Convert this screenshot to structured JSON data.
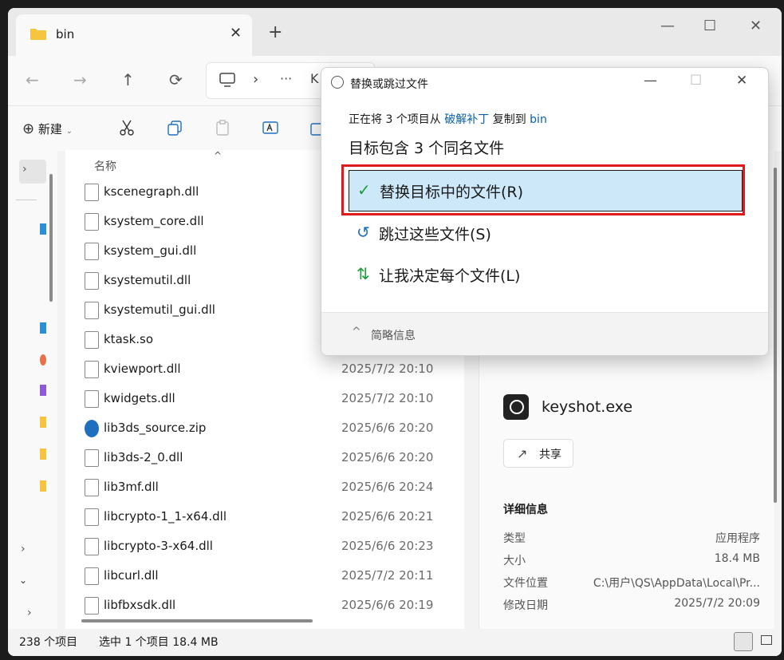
{
  "tab": {
    "title": "bin",
    "close": "✕",
    "new_tab": "+"
  },
  "window_controls": {
    "minimize": "—",
    "maximize": "☐",
    "close": "✕"
  },
  "nav": {
    "back": "←",
    "forward": "→",
    "up": "↑",
    "refresh": "⟳",
    "more": "···",
    "sep": "›",
    "partial_path": "K"
  },
  "toolbar": {
    "new_label": "新建",
    "new_icon": "⊕"
  },
  "file_list": {
    "column_name": "名称",
    "rows": [
      {
        "name": "kscenegraph.dll",
        "date": ""
      },
      {
        "name": "ksystem_core.dll",
        "date": ""
      },
      {
        "name": "ksystem_gui.dll",
        "date": ""
      },
      {
        "name": "ksystemutil.dll",
        "date": ""
      },
      {
        "name": "ksystemutil_gui.dll",
        "date": ""
      },
      {
        "name": "ktask.so",
        "date": ""
      },
      {
        "name": "kviewport.dll",
        "date": "2025/7/2 20:10"
      },
      {
        "name": "kwidgets.dll",
        "date": "2025/7/2 20:10"
      },
      {
        "name": "lib3ds_source.zip",
        "date": "2025/6/6 20:20"
      },
      {
        "name": "lib3ds-2_0.dll",
        "date": "2025/6/6 20:20"
      },
      {
        "name": "lib3mf.dll",
        "date": "2025/6/6 20:24"
      },
      {
        "name": "libcrypto-1_1-x64.dll",
        "date": "2025/6/6 20:21"
      },
      {
        "name": "libcrypto-3-x64.dll",
        "date": "2025/6/6 20:23"
      },
      {
        "name": "libcurl.dll",
        "date": "2025/7/2 20:11"
      },
      {
        "name": "libfbxsdk.dll",
        "date": "2025/6/6 20:19"
      }
    ]
  },
  "details": {
    "file_name": "keyshot.exe",
    "share_label": "共享",
    "heading": "详细信息",
    "props": [
      {
        "key": "类型",
        "value": "应用程序"
      },
      {
        "key": "大小",
        "value": "18.4 MB"
      },
      {
        "key": "文件位置",
        "value": "C:\\用户\\QS\\AppData\\Local\\Pr..."
      },
      {
        "key": "修改日期",
        "value": "2025/7/2 20:09"
      }
    ]
  },
  "status": {
    "count": "238 个项目",
    "selected": "选中 1 个项目  18.4 MB"
  },
  "dialog": {
    "title": "替换或跳过文件",
    "line1_pre": "正在将 3 个项目从",
    "line1_src": "破解补丁",
    "line1_mid": "复制到",
    "line1_dst": "bin",
    "line2": "目标包含 3 个同名文件",
    "opt_replace": "替换目标中的文件(R)",
    "opt_skip": "跳过这些文件(S)",
    "opt_decide": "让我决定每个文件(L)",
    "footer": "简略信息"
  },
  "colors": {
    "accent": "#0a5fa8",
    "selected_bg": "#cde8f9",
    "highlight": "#e01a1a"
  }
}
